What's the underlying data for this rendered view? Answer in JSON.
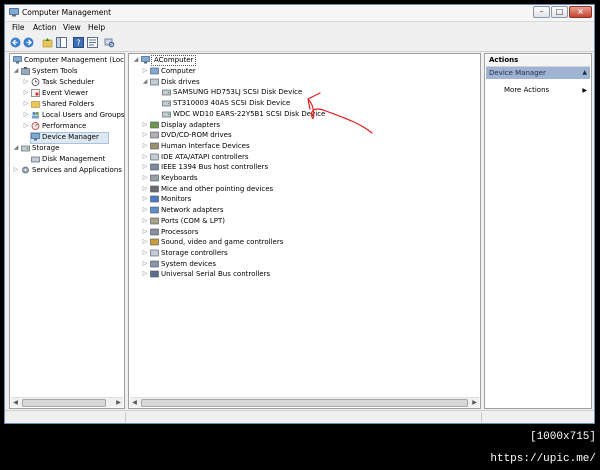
{
  "window": {
    "title": "Computer Management"
  },
  "menu": {
    "file": "File",
    "action": "Action",
    "view": "View",
    "help": "Help"
  },
  "left_tree": {
    "root": "Computer Management (Local",
    "system_tools": "System Tools",
    "task_scheduler": "Task Scheduler",
    "event_viewer": "Event Viewer",
    "shared_folders": "Shared Folders",
    "local_users": "Local Users and Groups",
    "performance": "Performance",
    "device_manager": "Device Manager",
    "storage": "Storage",
    "disk_management": "Disk Management",
    "services": "Services and Applications"
  },
  "device_tree": {
    "computer_name": "AComputer",
    "categories": [
      "Computer",
      "Disk drives",
      "Display adapters",
      "DVD/CD-ROM drives",
      "Human Interface Devices",
      "IDE ATA/ATAPI controllers",
      "IEEE 1394 Bus host controllers",
      "Keyboards",
      "Mice and other pointing devices",
      "Monitors",
      "Network adapters",
      "Ports (COM & LPT)",
      "Processors",
      "Sound, video and game controllers",
      "Storage controllers",
      "System devices",
      "Universal Serial Bus controllers"
    ],
    "disks": [
      "SAMSUNG HD753LJ SCSI Disk Device",
      "ST310003 40AS SCSI Disk Device",
      "WDC WD10 EARS-22Y5B1 SCSI Disk Device"
    ]
  },
  "actions": {
    "header": "Actions",
    "section": "Device Manager",
    "more": "More Actions"
  },
  "watermark": "[1000x715] https://upic.me/",
  "colors": {
    "annotation_arrow": "#e0201c",
    "selection": "#dde8f3",
    "actions_section": "#9fb4d2"
  }
}
